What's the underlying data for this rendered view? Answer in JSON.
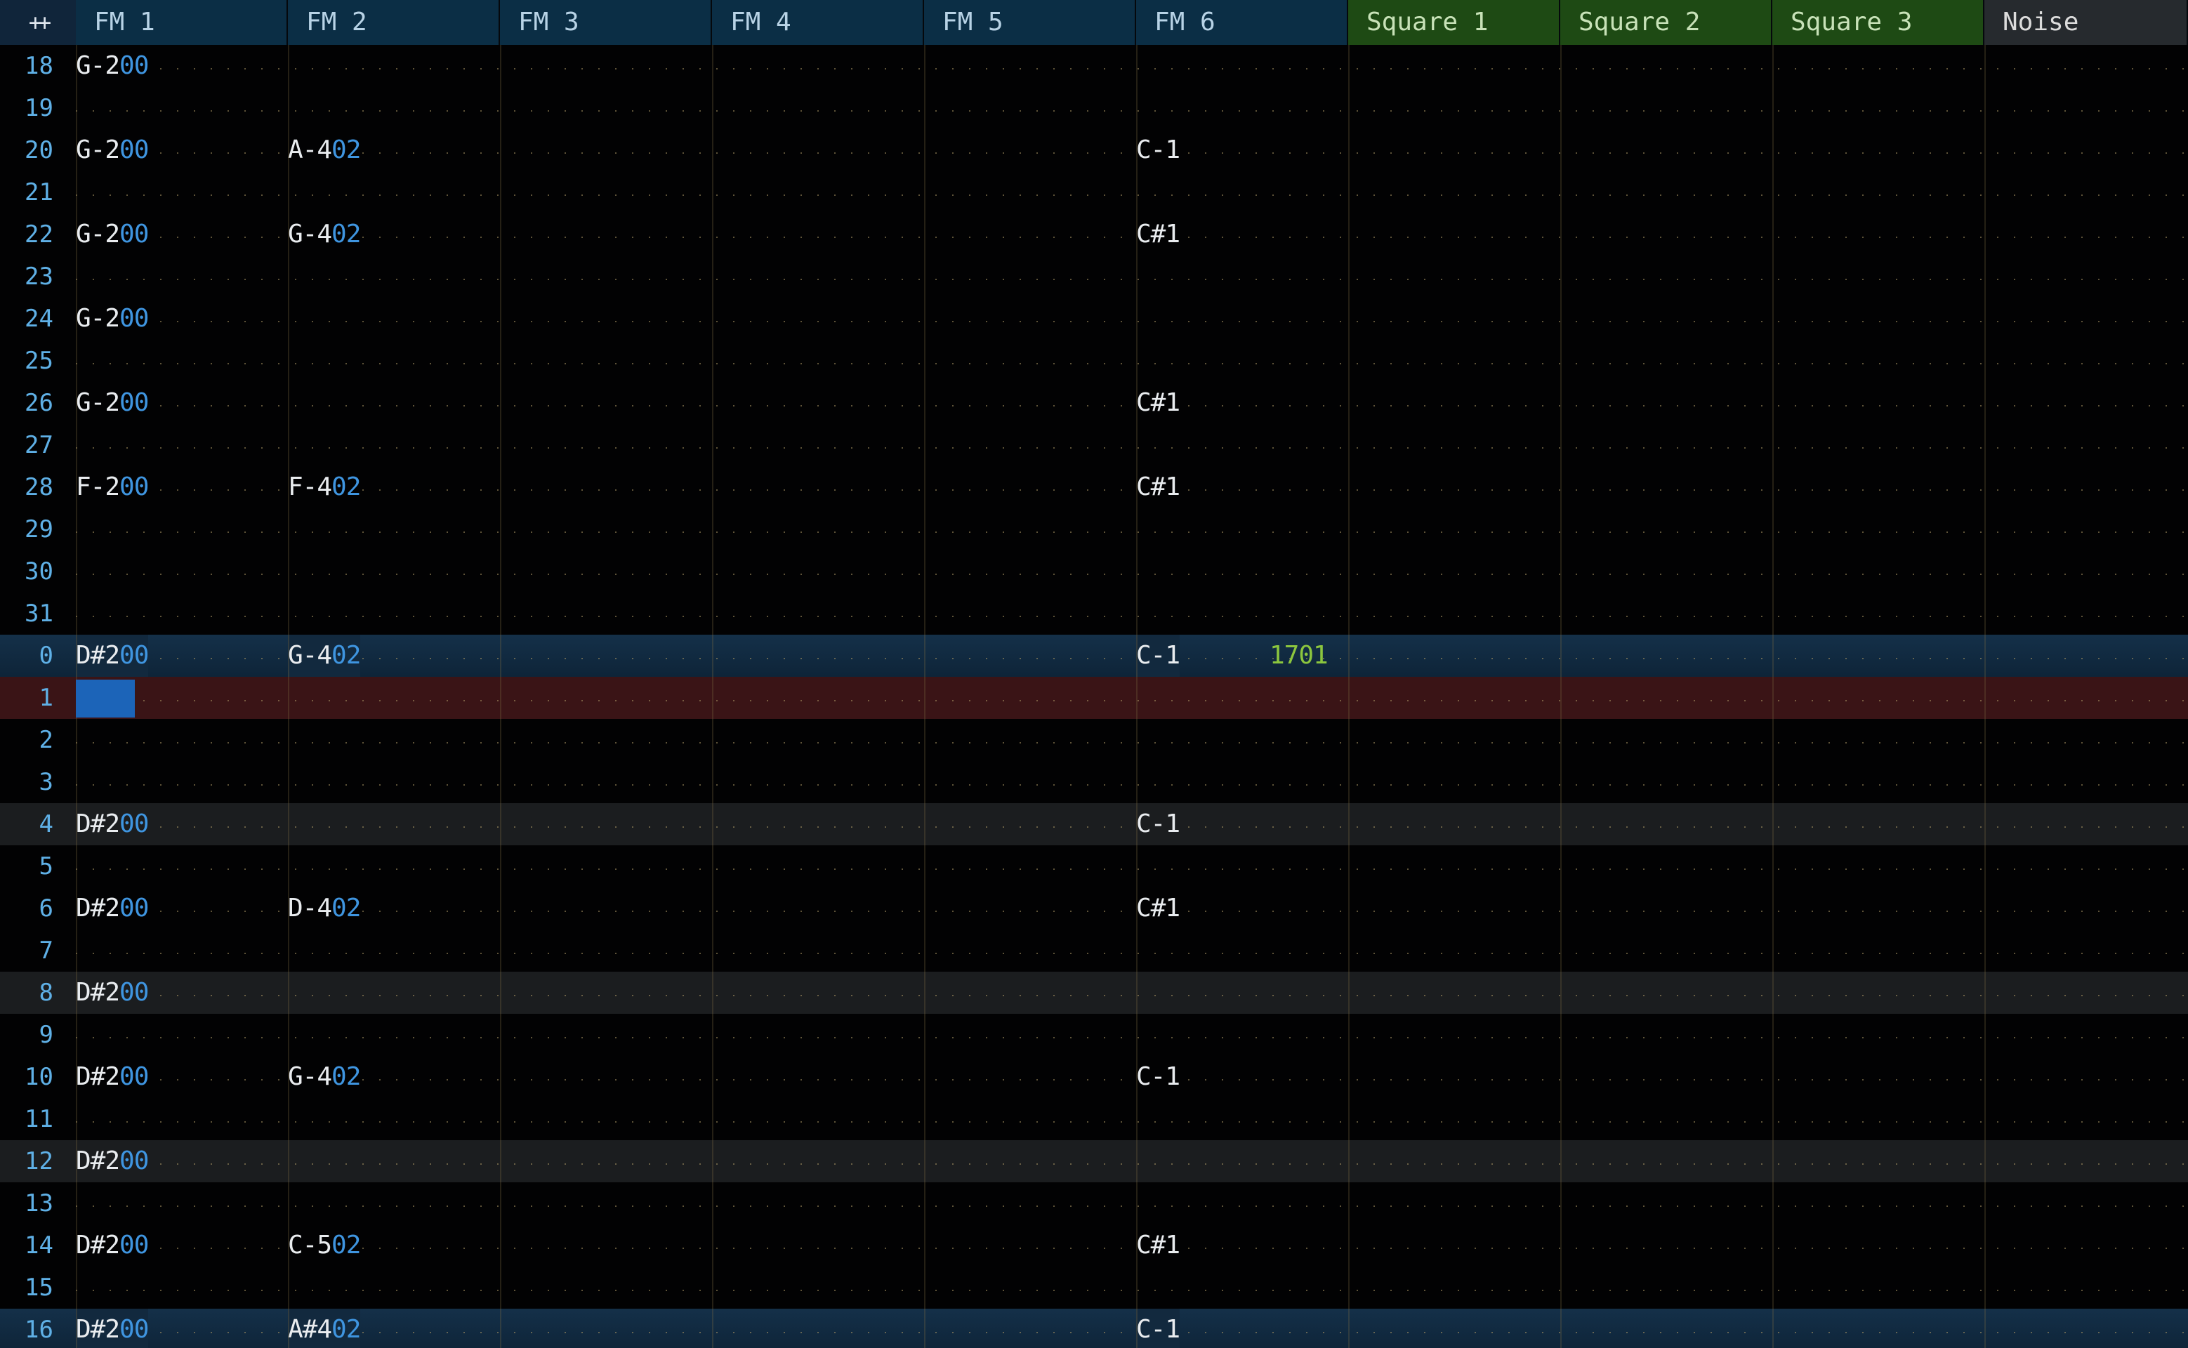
{
  "corner_label": "++",
  "channels": [
    {
      "name": "FM 1",
      "kind": "fm"
    },
    {
      "name": "FM 2",
      "kind": "fm"
    },
    {
      "name": "FM 3",
      "kind": "fm"
    },
    {
      "name": "FM 4",
      "kind": "fm"
    },
    {
      "name": "FM 5",
      "kind": "fm"
    },
    {
      "name": "FM 6",
      "kind": "fm"
    },
    {
      "name": "Square 1",
      "kind": "square"
    },
    {
      "name": "Square 2",
      "kind": "square"
    },
    {
      "name": "Square 3",
      "kind": "square"
    },
    {
      "name": "Noise",
      "kind": "noise"
    }
  ],
  "rows": [
    {
      "num": "18",
      "highlight": "",
      "cells": {
        "0": {
          "note": "G-2",
          "inst": "00"
        }
      }
    },
    {
      "num": "19",
      "highlight": "",
      "cells": {}
    },
    {
      "num": "20",
      "highlight": "",
      "cells": {
        "0": {
          "note": "G-2",
          "inst": "00"
        },
        "1": {
          "note": "A-4",
          "inst": "02"
        },
        "5": {
          "note": "C-1"
        }
      }
    },
    {
      "num": "21",
      "highlight": "",
      "cells": {}
    },
    {
      "num": "22",
      "highlight": "",
      "cells": {
        "0": {
          "note": "G-2",
          "inst": "00"
        },
        "1": {
          "note": "G-4",
          "inst": "02"
        },
        "5": {
          "note": "C#1"
        }
      }
    },
    {
      "num": "23",
      "highlight": "",
      "cells": {}
    },
    {
      "num": "24",
      "highlight": "",
      "cells": {
        "0": {
          "note": "G-2",
          "inst": "00"
        }
      }
    },
    {
      "num": "25",
      "highlight": "",
      "cells": {}
    },
    {
      "num": "26",
      "highlight": "",
      "cells": {
        "0": {
          "note": "G-2",
          "inst": "00"
        },
        "5": {
          "note": "C#1"
        }
      }
    },
    {
      "num": "27",
      "highlight": "",
      "cells": {}
    },
    {
      "num": "28",
      "highlight": "",
      "cells": {
        "0": {
          "note": "F-2",
          "inst": "00"
        },
        "1": {
          "note": "F-4",
          "inst": "02"
        },
        "5": {
          "note": "C#1"
        }
      }
    },
    {
      "num": "29",
      "highlight": "",
      "cells": {}
    },
    {
      "num": "30",
      "highlight": "",
      "cells": {}
    },
    {
      "num": "31",
      "highlight": "",
      "cells": {}
    },
    {
      "num": "0",
      "highlight": "blue",
      "cells": {
        "0": {
          "note": "D#2",
          "inst": "00"
        },
        "1": {
          "note": "G-4",
          "inst": "02"
        },
        "5": {
          "note": "C-1",
          "fx": "1701"
        }
      }
    },
    {
      "num": "1",
      "highlight": "red",
      "cells": {}
    },
    {
      "num": "2",
      "highlight": "",
      "cells": {}
    },
    {
      "num": "3",
      "highlight": "",
      "cells": {}
    },
    {
      "num": "4",
      "highlight": "gray",
      "cells": {
        "0": {
          "note": "D#2",
          "inst": "00"
        },
        "5": {
          "note": "C-1"
        }
      }
    },
    {
      "num": "5",
      "highlight": "",
      "cells": {}
    },
    {
      "num": "6",
      "highlight": "",
      "cells": {
        "0": {
          "note": "D#2",
          "inst": "00"
        },
        "1": {
          "note": "D-4",
          "inst": "02"
        },
        "5": {
          "note": "C#1"
        }
      }
    },
    {
      "num": "7",
      "highlight": "",
      "cells": {}
    },
    {
      "num": "8",
      "highlight": "gray",
      "cells": {
        "0": {
          "note": "D#2",
          "inst": "00"
        }
      }
    },
    {
      "num": "9",
      "highlight": "",
      "cells": {}
    },
    {
      "num": "10",
      "highlight": "",
      "cells": {
        "0": {
          "note": "D#2",
          "inst": "00"
        },
        "1": {
          "note": "G-4",
          "inst": "02"
        },
        "5": {
          "note": "C-1"
        }
      }
    },
    {
      "num": "11",
      "highlight": "",
      "cells": {}
    },
    {
      "num": "12",
      "highlight": "gray",
      "cells": {
        "0": {
          "note": "D#2",
          "inst": "00"
        }
      }
    },
    {
      "num": "13",
      "highlight": "",
      "cells": {}
    },
    {
      "num": "14",
      "highlight": "",
      "cells": {
        "0": {
          "note": "D#2",
          "inst": "00"
        },
        "1": {
          "note": "C-5",
          "inst": "02"
        },
        "5": {
          "note": "C#1"
        }
      }
    },
    {
      "num": "15",
      "highlight": "",
      "cells": {}
    },
    {
      "num": "16",
      "highlight": "blue",
      "cells": {
        "0": {
          "note": "D#2",
          "inst": "00"
        },
        "1": {
          "note": "A#4",
          "inst": "02"
        },
        "5": {
          "note": "C-1"
        }
      }
    }
  ],
  "colors": {
    "fm_header": "#0b2e45",
    "square_header": "#1e4a14",
    "noise_header": "#262a2e",
    "row_number": "#5fb0e6",
    "note": "#e9ecef",
    "instrument": "#3f95e0",
    "effect": "#8cc63e",
    "beat_highlight": "#143049",
    "cursor_row": "#3a1416",
    "cursor": "#1c64b8"
  }
}
